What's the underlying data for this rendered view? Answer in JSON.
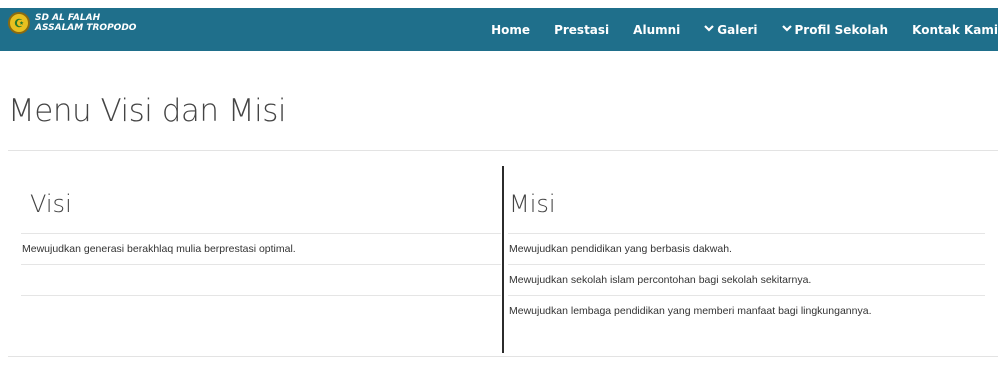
{
  "brand": {
    "line1": "SD AL FALAH",
    "line2": "ASSALAM TROPODO",
    "logo_icon": "school-emblem-icon"
  },
  "nav": {
    "items": [
      {
        "label": "Home",
        "has_dropdown": false
      },
      {
        "label": "Prestasi",
        "has_dropdown": false
      },
      {
        "label": "Alumni",
        "has_dropdown": false
      },
      {
        "label": "Galeri",
        "has_dropdown": true
      },
      {
        "label": "Profil Sekolah",
        "has_dropdown": true
      },
      {
        "label": "Kontak Kami",
        "has_dropdown": false
      }
    ],
    "chevron": "❯"
  },
  "page": {
    "title": "Menu Visi dan Misi"
  },
  "visi": {
    "title": "Visi",
    "rows": [
      "Mewujudkan generasi berakhlaq mulia berprestasi optimal.",
      "",
      ""
    ]
  },
  "misi": {
    "title": "Misi",
    "rows": [
      "Mewujudkan pendidikan yang berbasis dakwah.",
      "Mewujudkan sekolah islam percontohan bagi sekolah sekitarnya.",
      "Mewujudkan lembaga pendidikan yang memberi manfaat bagi lingkungannya."
    ]
  },
  "colors": {
    "navbar": "#1f6f8b",
    "text": "#333333",
    "divider": "#2b2b2b"
  }
}
